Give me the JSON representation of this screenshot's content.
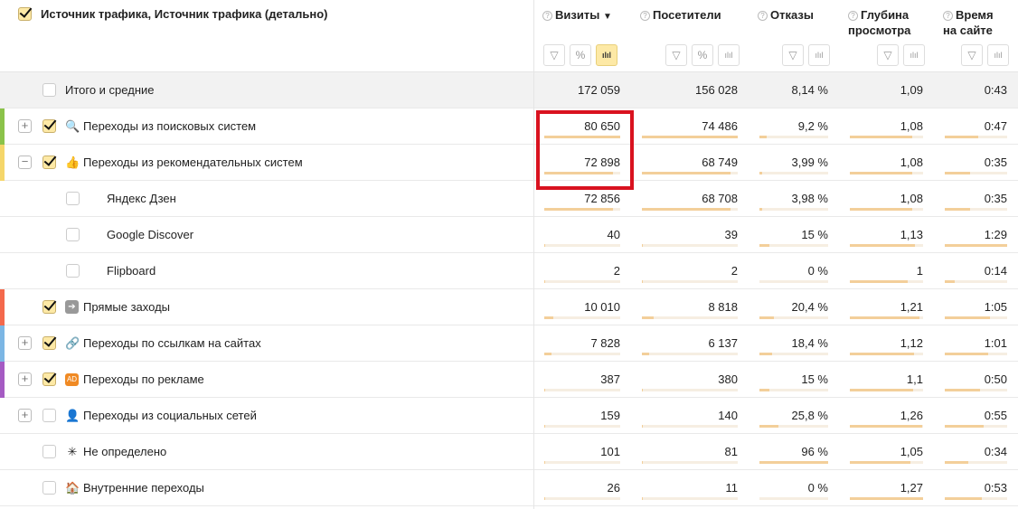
{
  "header": {
    "dimension_title": "Источник трафика, Источник трафика (детально)",
    "metrics": [
      {
        "label": "Визиты",
        "sort": "▼",
        "buttons": [
          "filter",
          "percent",
          "chart-on"
        ]
      },
      {
        "label": "Посетители",
        "buttons": [
          "filter",
          "percent",
          "chart"
        ]
      },
      {
        "label": "Отказы",
        "buttons": [
          "filter",
          "chart"
        ]
      },
      {
        "label": "Глубина\nпросмотра",
        "buttons": [
          "filter",
          "chart"
        ]
      },
      {
        "label": "Время\nна сайте",
        "buttons": [
          "filter",
          "chart"
        ]
      }
    ]
  },
  "colors": {
    "search": "#8bc34a",
    "recommend": "#f5d66a",
    "direct": "#f4694c",
    "links": "#7cb6e4",
    "ads": "#a55bc3"
  },
  "rows": [
    {
      "label": "Итого и средние",
      "type": "total",
      "checked": false,
      "values": [
        "172 059",
        "156 028",
        "8,14 %",
        "1,09",
        "0:43"
      ],
      "bars": null
    },
    {
      "label": "Переходы из поисковых систем",
      "expand": "+",
      "checked": true,
      "icon": "search-icon",
      "glyph": "🔍",
      "stripe": "#8bc34a",
      "values": [
        "80 650",
        "74 486",
        "9,2 %",
        "1,08",
        "0:47"
      ],
      "bars": [
        1,
        1,
        0.1,
        0.85,
        0.53
      ]
    },
    {
      "label": "Переходы из рекомендательных систем",
      "expand": "−",
      "checked": true,
      "icon": "thumbs-up-icon",
      "glyph": "👍",
      "stripe": "#f5d66a",
      "values": [
        "72 898",
        "68 749",
        "3,99 %",
        "1,08",
        "0:35"
      ],
      "bars": [
        0.9,
        0.92,
        0.04,
        0.85,
        0.4
      ]
    },
    {
      "label": "Яндекс Дзен",
      "child": true,
      "checked": false,
      "values": [
        "72 856",
        "68 708",
        "3,98 %",
        "1,08",
        "0:35"
      ],
      "bars": [
        0.9,
        0.92,
        0.04,
        0.85,
        0.4
      ]
    },
    {
      "label": "Google Discover",
      "child": true,
      "checked": false,
      "values": [
        "40",
        "39",
        "15 %",
        "1,13",
        "1:29"
      ],
      "bars": [
        0.01,
        0.01,
        0.15,
        0.89,
        1
      ]
    },
    {
      "label": "Flipboard",
      "child": true,
      "checked": false,
      "values": [
        "2",
        "2",
        "0 %",
        "1",
        "0:14"
      ],
      "bars": [
        0.005,
        0.005,
        0,
        0.79,
        0.16
      ]
    },
    {
      "label": "Прямые заходы",
      "checked": true,
      "icon": "arrow-right-icon",
      "glyph": "➔",
      "stripe": "#f4694c",
      "values": [
        "10 010",
        "8 818",
        "20,4 %",
        "1,21",
        "1:05"
      ],
      "bars": [
        0.12,
        0.12,
        0.21,
        0.95,
        0.73
      ]
    },
    {
      "label": "Переходы по ссылкам на сайтах",
      "expand": "+",
      "checked": true,
      "icon": "link-icon",
      "glyph": "🔗",
      "stripe": "#7cb6e4",
      "values": [
        "7 828",
        "6 137",
        "18,4 %",
        "1,12",
        "1:01"
      ],
      "bars": [
        0.1,
        0.08,
        0.19,
        0.88,
        0.69
      ]
    },
    {
      "label": "Переходы по рекламе",
      "expand": "+",
      "checked": true,
      "icon": "ad-icon",
      "glyph": "AD",
      "stripe": "#a55bc3",
      "values": [
        "387",
        "380",
        "15 %",
        "1,1",
        "0:50"
      ],
      "bars": [
        0.01,
        0.01,
        0.15,
        0.87,
        0.56
      ]
    },
    {
      "label": "Переходы из социальных сетей",
      "expand": "+",
      "checked": false,
      "icon": "user-icon",
      "glyph": "👤",
      "values": [
        "159",
        "140",
        "25,8 %",
        "1,26",
        "0:55"
      ],
      "bars": [
        0.01,
        0.01,
        0.27,
        0.99,
        0.62
      ]
    },
    {
      "label": "Не определено",
      "checked": false,
      "icon": "loading-icon",
      "glyph": "✳",
      "values": [
        "101",
        "81",
        "96 %",
        "1,05",
        "0:34"
      ],
      "bars": [
        0.01,
        0.01,
        1,
        0.83,
        0.38
      ]
    },
    {
      "label": "Внутренние переходы",
      "checked": false,
      "icon": "home-icon",
      "glyph": "🏠",
      "values": [
        "26",
        "11",
        "0 %",
        "1,27",
        "0:53"
      ],
      "bars": [
        0.005,
        0.005,
        0,
        1,
        0.6
      ]
    }
  ]
}
